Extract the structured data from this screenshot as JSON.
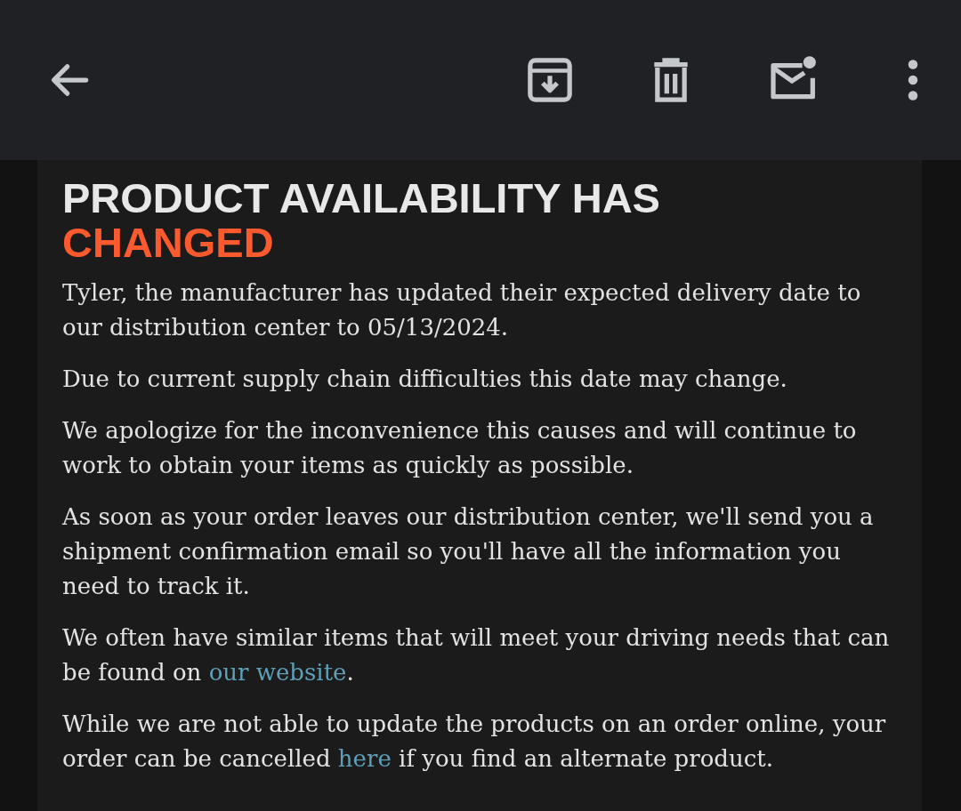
{
  "toolbar": {
    "actions": [
      {
        "kind": "back"
      },
      {
        "kind": "archive"
      },
      {
        "kind": "delete"
      },
      {
        "kind": "unread"
      },
      {
        "kind": "more"
      }
    ]
  },
  "heading": [
    {
      "kind": "plain",
      "text": "PRODUCT AVAILABILITY HAS"
    },
    {
      "kind": "accent",
      "text": "CHANGED"
    }
  ],
  "paragraphs": [
    {
      "parts": [
        {
          "kind": "text",
          "text": "Tyler, the manufacturer has updated their expected delivery date to our distribution center to 05/13/2024."
        }
      ]
    },
    {
      "parts": [
        {
          "kind": "text",
          "text": "Due to current supply chain difficulties this date may change."
        }
      ]
    },
    {
      "parts": [
        {
          "kind": "text",
          "text": "We apologize for the inconvenience this causes and will continue to work to obtain your items as quickly as possible."
        }
      ]
    },
    {
      "parts": [
        {
          "kind": "text",
          "text": "As soon as your order leaves our distribution center, we'll send you a shipment confirmation email so you'll have all the information you need to track it."
        }
      ]
    },
    {
      "parts": [
        {
          "kind": "text",
          "text": "We often have similar items that will meet your driving needs that can be found on "
        },
        {
          "kind": "link",
          "text": "our website"
        },
        {
          "kind": "text",
          "text": "."
        }
      ]
    },
    {
      "parts": [
        {
          "kind": "text",
          "text": "While we are not able to update the products on an order online, your order can be cancelled "
        },
        {
          "kind": "link",
          "text": "here"
        },
        {
          "kind": "text",
          "text": " if you find an alternate product."
        }
      ]
    }
  ]
}
